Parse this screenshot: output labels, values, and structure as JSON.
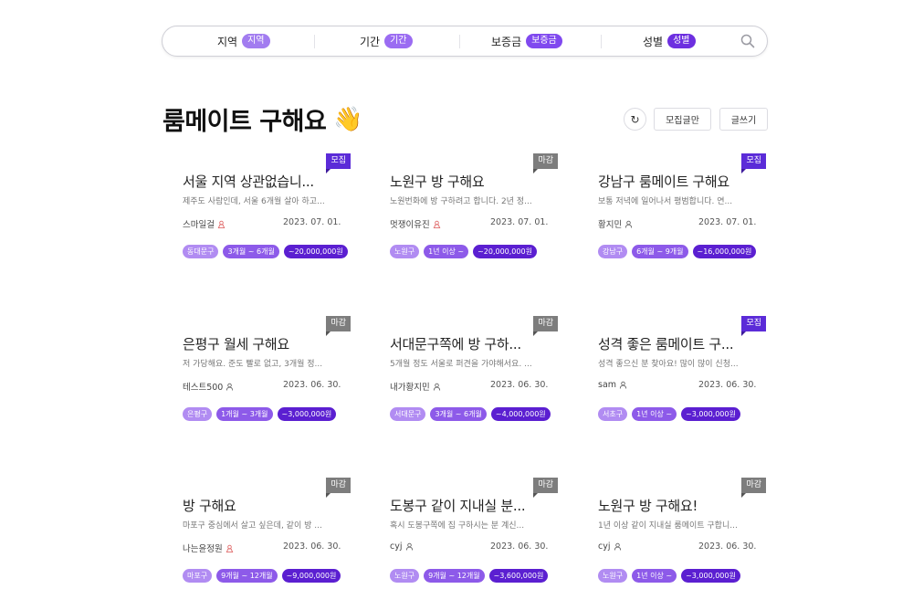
{
  "filters": [
    {
      "label": "지역",
      "chip": "지역"
    },
    {
      "label": "기간",
      "chip": "기간"
    },
    {
      "label": "보증금",
      "chip": "보증금"
    },
    {
      "label": "성별",
      "chip": "성별"
    }
  ],
  "search_icon": "search-icon",
  "heading": {
    "title": "룸메이트 구해요",
    "emoji": "👋"
  },
  "toolbar": {
    "refresh_icon": "↻",
    "recruit_label": "모집글만",
    "write_label": "글쓰기"
  },
  "colors": {
    "accent": "#5b2bd8",
    "tag_light": "#b18cf2",
    "tag_mid": "#8d5ae9",
    "tag_dark": "#5b1fd1",
    "closed": "#7d7d7d"
  },
  "cards": [
    {
      "badge": "모집",
      "status": "open",
      "title": "서울 지역 상관없습니...",
      "desc": "제주도 사람인데, 서울 6개월 살아 하고...",
      "author": "스마일걸",
      "author_icon": "female-icon",
      "date": "2023. 07. 01.",
      "tags": [
        "동대문구",
        "3개월 ~ 6개월",
        "~20,000,000원"
      ]
    },
    {
      "badge": "마감",
      "status": "closed",
      "title": "노원구 방 구해요",
      "desc": "노원번화에 방 구하려고 합니다. 2년 정...",
      "author": "멋쟁이유진",
      "author_icon": "female-icon",
      "date": "2023. 07. 01.",
      "tags": [
        "노원구",
        "1년 이상 ~",
        "~20,000,000원"
      ]
    },
    {
      "badge": "모집",
      "status": "open",
      "title": "강남구 룸메이트 구해요",
      "desc": "보통 저녁에 일어나서 평범합니다. 연...",
      "author": "황지민",
      "author_icon": "male-icon",
      "date": "2023. 07. 01.",
      "tags": [
        "강남구",
        "6개월 ~ 9개월",
        "~16,000,000원"
      ]
    },
    {
      "badge": "마감",
      "status": "closed",
      "title": "은평구 월세 구해요",
      "desc": "저 가당해요. 준도 빨로 없고, 3개월 정...",
      "author": "테스트500",
      "author_icon": "male-icon",
      "date": "2023. 06. 30.",
      "tags": [
        "은평구",
        "1개월 ~ 3개월",
        "~3,000,000원"
      ]
    },
    {
      "badge": "마감",
      "status": "closed",
      "title": "서대문구쪽에 방 구하...",
      "desc": "5개월 정도 서울로 퍼견을 가야해서요. ...",
      "author": "내가황지민",
      "author_icon": "male-icon",
      "date": "2023. 06. 30.",
      "tags": [
        "서대문구",
        "3개월 ~ 6개월",
        "~4,000,000원"
      ]
    },
    {
      "badge": "모집",
      "status": "open",
      "title": "성격 좋은 룸메이트 구...",
      "desc": "성격 좋으신 분 찾아요! 많이 많이 신청...",
      "author": "sam",
      "author_icon": "male-icon",
      "date": "2023. 06. 30.",
      "tags": [
        "서초구",
        "1년 이상 ~",
        "~3,000,000원"
      ]
    },
    {
      "badge": "마감",
      "status": "closed",
      "title": "방 구해요",
      "desc": "마포구 중심에서 살고 싶은데, 같이 방 ...",
      "author": "나는윤정원",
      "author_icon": "female-icon",
      "date": "2023. 06. 30.",
      "tags": [
        "마포구",
        "9개월 ~ 12개월",
        "~9,000,000원"
      ]
    },
    {
      "badge": "마감",
      "status": "closed",
      "title": "도봉구 같이 지내실 분...",
      "desc": "혹시 도봉구쪽에 집 구하시는 분 계신...",
      "author": "cyj",
      "author_icon": "male-icon",
      "date": "2023. 06. 30.",
      "tags": [
        "노원구",
        "9개월 ~ 12개월",
        "~3,600,000원"
      ]
    },
    {
      "badge": "마감",
      "status": "closed",
      "title": "노원구 방 구해요!",
      "desc": "1년 이상 같이 지내실 룸메이트 구합니...",
      "author": "cyj",
      "author_icon": "male-icon",
      "date": "2023. 06. 30.",
      "tags": [
        "노원구",
        "1년 이상 ~",
        "~3,000,000원"
      ]
    }
  ]
}
